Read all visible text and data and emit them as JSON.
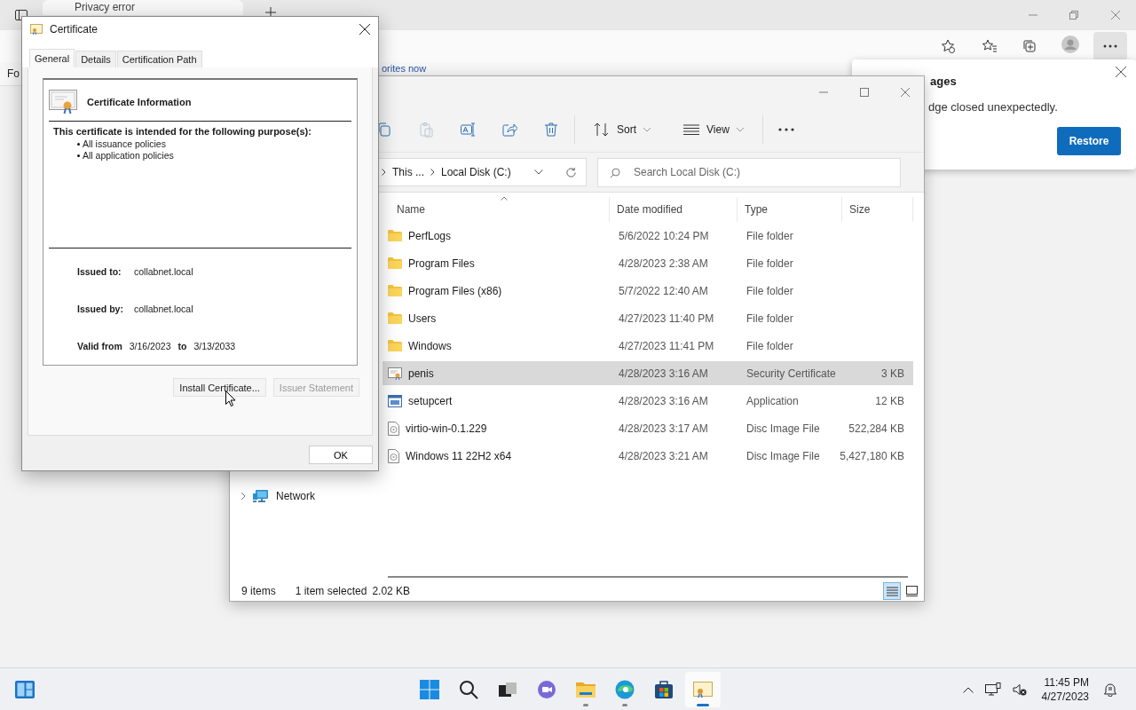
{
  "browser": {
    "tab_title": "Privacy error",
    "favorites_fragment": "Fo",
    "link_fragment": "orites now"
  },
  "notification": {
    "title_fragment": "ages",
    "message_fragment": "dge closed unexpectedly.",
    "button": "Restore"
  },
  "explorer": {
    "toolbar": [
      {
        "kind": "copy",
        "disabled": false
      },
      {
        "kind": "paste",
        "disabled": true
      },
      {
        "kind": "rename",
        "disabled": false
      },
      {
        "kind": "share",
        "disabled": false
      },
      {
        "kind": "delete",
        "disabled": false
      }
    ],
    "sort_label": "Sort",
    "view_label": "View",
    "breadcrumb": [
      "This ...",
      "Local Disk (C:)"
    ],
    "search": {
      "placeholder": "Search Local Disk (C:)"
    },
    "nav": [
      {
        "label": "Network",
        "expanded": false
      }
    ],
    "columns": [
      "Name",
      "Date modified",
      "Type",
      "Size"
    ],
    "rows": [
      {
        "name": "PerfLogs",
        "date": "5/6/2022 10:24 PM",
        "type": "File folder",
        "size": "",
        "kind": "folder",
        "selected": false
      },
      {
        "name": "Program Files",
        "date": "4/28/2023 2:38 AM",
        "type": "File folder",
        "size": "",
        "kind": "folder",
        "selected": false
      },
      {
        "name": "Program Files (x86)",
        "date": "5/7/2022 12:40 AM",
        "type": "File folder",
        "size": "",
        "kind": "folder",
        "selected": false
      },
      {
        "name": "Users",
        "date": "4/27/2023 11:40 PM",
        "type": "File folder",
        "size": "",
        "kind": "folder",
        "selected": false
      },
      {
        "name": "Windows",
        "date": "4/27/2023 11:41 PM",
        "type": "File folder",
        "size": "",
        "kind": "folder",
        "selected": false
      },
      {
        "name": "penis",
        "date": "4/28/2023 3:16 AM",
        "type": "Security Certificate",
        "size": "3 KB",
        "kind": "certificate",
        "selected": true
      },
      {
        "name": "setupcert",
        "date": "4/28/2023 3:16 AM",
        "type": "Application",
        "size": "12 KB",
        "kind": "application",
        "selected": false
      },
      {
        "name": "virtio-win-0.1.229",
        "date": "4/28/2023 3:17 AM",
        "type": "Disc Image File",
        "size": "522,284 KB",
        "kind": "disc",
        "selected": false
      },
      {
        "name": "Windows 11 22H2 x64",
        "date": "4/28/2023 3:21 AM",
        "type": "Disc Image File",
        "size": "5,427,180 KB",
        "kind": "disc",
        "selected": false
      }
    ],
    "status": {
      "count": "9 items",
      "selection": "1 item selected",
      "size": "2.02 KB"
    },
    "views": [
      {
        "kind": "details",
        "selected": true
      },
      {
        "kind": "tiles",
        "selected": false
      }
    ]
  },
  "dialog": {
    "title": "Certificate",
    "tabs": [
      {
        "label": "General",
        "selected": true
      },
      {
        "label": "Details",
        "selected": false
      },
      {
        "label": "Certification Path",
        "selected": false
      }
    ],
    "heading": "Certificate Information",
    "purpose_heading": "This certificate is intended for the following purpose(s):",
    "purposes": [
      "All issuance policies",
      "All application policies"
    ],
    "issued_to_label": "Issued to:",
    "issued_to": "collabnet.local",
    "issued_by_label": "Issued by:",
    "issued_by": "collabnet.local",
    "valid_from_label": "Valid from",
    "valid_from": "3/16/2023",
    "valid_to_label": "to",
    "valid_to": "3/13/2033",
    "buttons": [
      {
        "label": "Install Certificate...",
        "disabled": false
      },
      {
        "label": "Issuer Statement",
        "disabled": true
      }
    ],
    "ok": "OK"
  },
  "taskbar": {
    "apps": [
      {
        "kind": "start",
        "running": false,
        "selected": false
      },
      {
        "kind": "search",
        "running": false,
        "selected": false
      },
      {
        "kind": "taskview",
        "running": false,
        "selected": false
      },
      {
        "kind": "chat",
        "running": false,
        "selected": false
      },
      {
        "kind": "explorer",
        "running": true,
        "selected": false
      },
      {
        "kind": "edge",
        "running": true,
        "selected": false
      },
      {
        "kind": "store",
        "running": false,
        "selected": false
      },
      {
        "kind": "certificate",
        "running": true,
        "selected": true
      }
    ],
    "time": "11:45 PM",
    "date": "4/27/2023"
  }
}
